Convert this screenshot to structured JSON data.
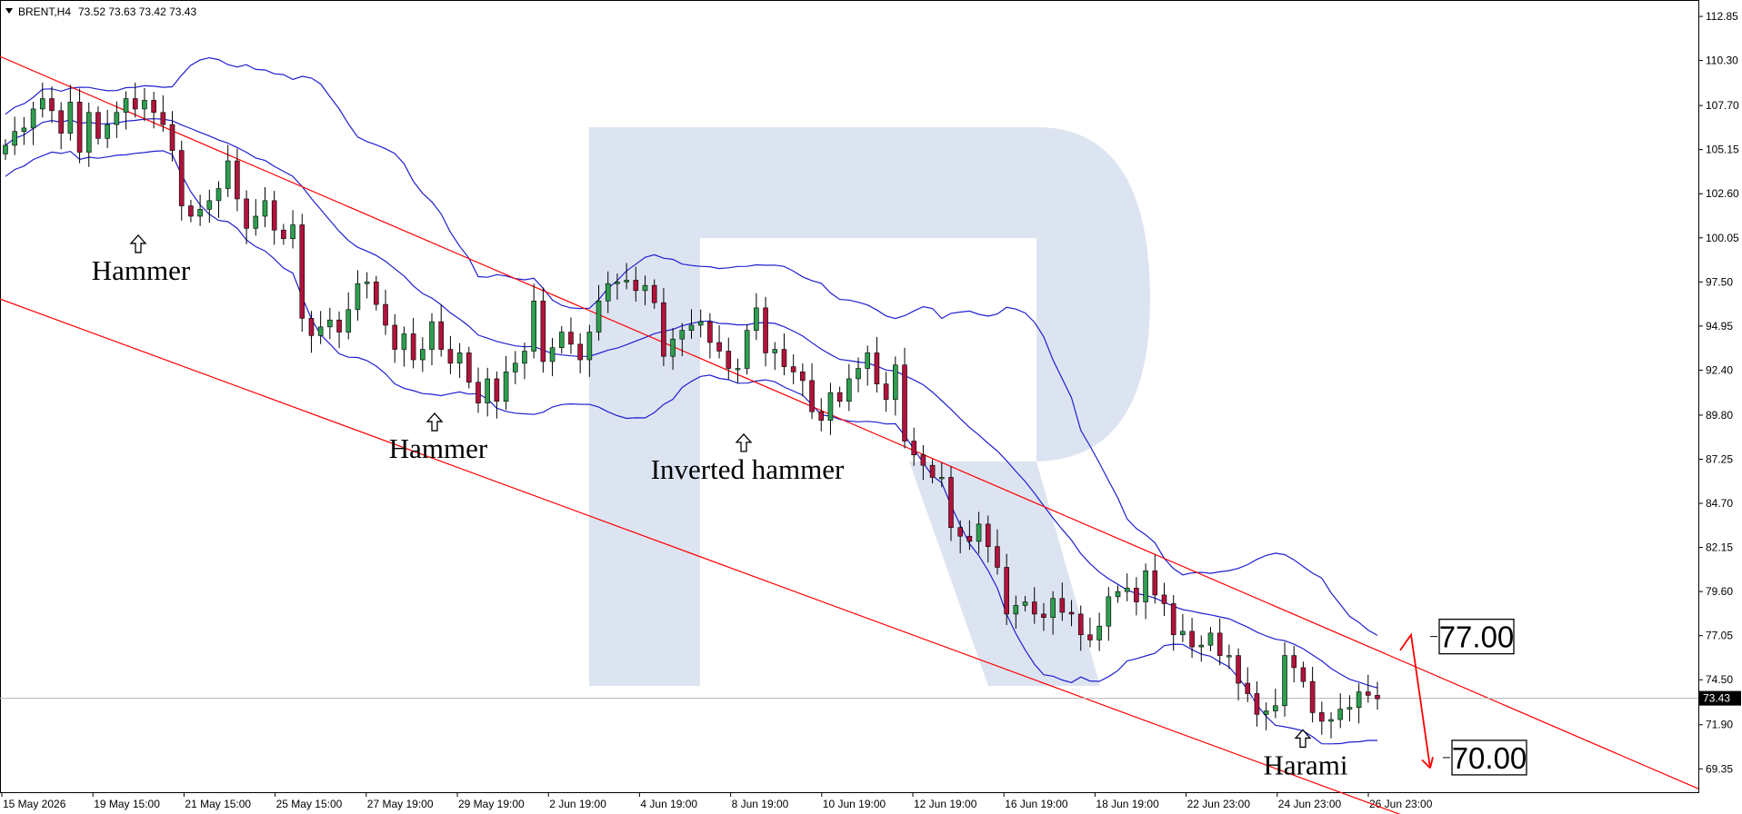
{
  "header": {
    "symbol": "BRENT,H4",
    "ohlc": "73.52 73.63 73.42 73.43"
  },
  "colors": {
    "bull": "#2e9e4f",
    "bear": "#b0133b",
    "bands": "#1f1fd0",
    "channel": "#ff0000",
    "watermark": "#dde4f1",
    "current_line": "#b4b4b4"
  },
  "chart_data": {
    "type": "candlestick",
    "title": "",
    "xlabel": "",
    "ylabel": "",
    "ylim": [
      68.0,
      113.8
    ],
    "grid": false,
    "y_ticks": [
      "112.85",
      "110.30",
      "107.70",
      "105.15",
      "102.60",
      "100.05",
      "97.50",
      "94.95",
      "92.40",
      "89.80",
      "87.25",
      "84.70",
      "82.15",
      "79.60",
      "77.05",
      "74.50",
      "71.90",
      "69.35"
    ],
    "x_ticks": [
      "15 May 2026",
      "19 May 15:00",
      "21 May 15:00",
      "25 May 15:00",
      "27 May 19:00",
      "29 May 19:00",
      "2 Jun 19:00",
      "4 Jun 19:00",
      "8 Jun 19:00",
      "10 Jun 19:00",
      "12 Jun 19:00",
      "16 Jun 19:00",
      "18 Jun 19:00",
      "22 Jun 23:00",
      "24 Jun 23:00",
      "26 Jun 23:00"
    ],
    "current_price": "73.43",
    "close_series": [
      105.4,
      106.2,
      106.4,
      107.5,
      108.1,
      107.4,
      106.1,
      107.9,
      105.0,
      107.3,
      105.8,
      106.6,
      107.3,
      108.1,
      107.5,
      108.0,
      107.3,
      106.6,
      105.1,
      101.9,
      101.3,
      101.7,
      102.2,
      102.9,
      104.5,
      102.3,
      100.6,
      101.3,
      102.2,
      100.5,
      100.0,
      100.8,
      95.4,
      94.4,
      94.9,
      95.3,
      94.6,
      95.9,
      97.4,
      97.5,
      96.2,
      95.0,
      93.6,
      94.5,
      93.0,
      93.6,
      95.2,
      93.6,
      92.8,
      93.4,
      91.7,
      90.5,
      91.9,
      90.6,
      92.3,
      92.8,
      93.5,
      96.4,
      92.9,
      93.7,
      94.6,
      93.9,
      93.0,
      94.6,
      96.4,
      97.4,
      97.5,
      97.6,
      97.0,
      97.3,
      96.3,
      93.2,
      94.2,
      94.7,
      95.0,
      95.2,
      94.0,
      93.5,
      92.5,
      92.5,
      94.7,
      96.0,
      93.4,
      93.6,
      92.6,
      92.3,
      91.8,
      90.0,
      89.5,
      91.1,
      90.6,
      91.9,
      92.5,
      93.4,
      91.6,
      90.7,
      92.7,
      88.3,
      87.5,
      86.9,
      86.2,
      86.2,
      83.3,
      82.8,
      82.5,
      83.5,
      82.2,
      81.0,
      78.3,
      78.8,
      79.0,
      78.3,
      78.1,
      79.2,
      78.4,
      78.3,
      77.1,
      76.8,
      77.6,
      79.3,
      79.6,
      79.8,
      79.0,
      80.8,
      79.4,
      78.9,
      77.1,
      77.3,
      76.4,
      76.5,
      77.2,
      75.9,
      75.9,
      74.3,
      73.7,
      72.5,
      72.7,
      73.0,
      75.9,
      75.2,
      74.4,
      72.6,
      72.1,
      72.2,
      72.8,
      72.9,
      73.8,
      73.6,
      73.4
    ],
    "series": [
      {
        "name": "upper channel",
        "points": [
          [
            "15 May 2026",
            110.4
          ],
          [
            "26 Jun 23:00",
            76.2
          ]
        ]
      },
      {
        "name": "lower channel",
        "points": [
          [
            "15 May 2026",
            96.4
          ],
          [
            "26 Jun 23:00",
            67.2
          ]
        ]
      }
    ],
    "annotations": [
      {
        "text": "Hammer",
        "price": 100.2
      },
      {
        "text": "Hammer",
        "price": 89.9
      },
      {
        "text": "Inverted hammer",
        "price": 88.7
      },
      {
        "text": "Harami",
        "price": 71.6
      }
    ],
    "levels": [
      "77.00",
      "70.00"
    ]
  }
}
